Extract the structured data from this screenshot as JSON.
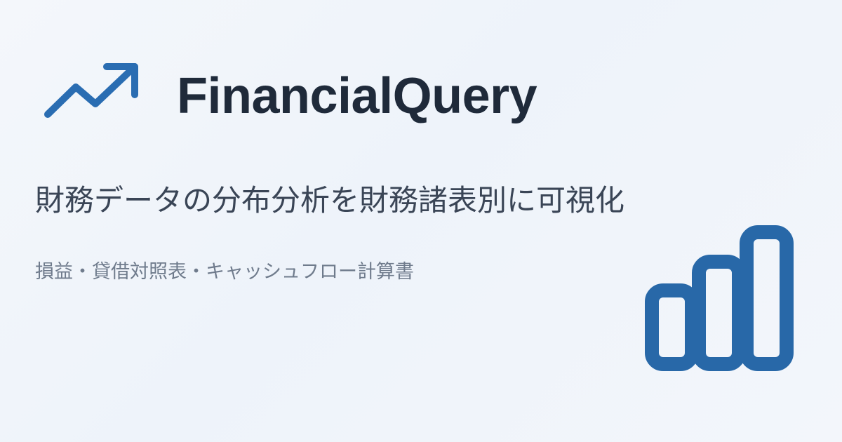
{
  "brand": {
    "name": "FinancialQuery",
    "logo_icon": "trending-up-arrow-icon",
    "accent_color": "#2a6db2"
  },
  "headline": "財務データの分布分析を財務諸表別に可視化",
  "subline": "損益・貸借対照表・キャッシュフロー計算書",
  "decor": {
    "icon": "bar-chart-icon",
    "color": "#2868a8"
  },
  "colors": {
    "title": "#1f2a3a",
    "headline": "#3a4556",
    "subline": "#6f7b8c"
  }
}
